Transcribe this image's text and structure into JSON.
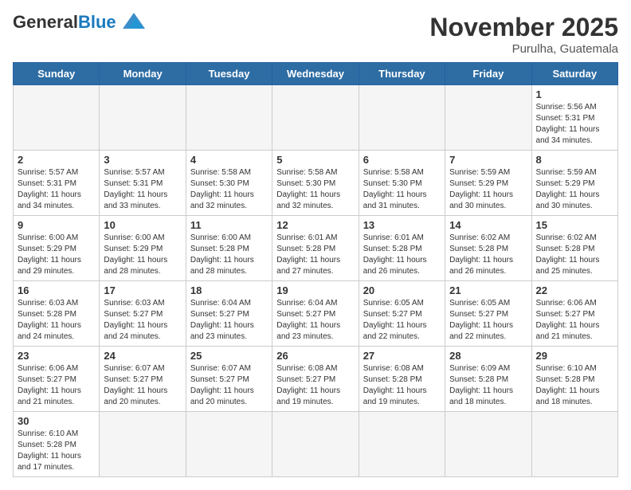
{
  "header": {
    "logo_general": "General",
    "logo_blue": "Blue",
    "month_title": "November 2025",
    "location": "Purulha, Guatemala"
  },
  "weekdays": [
    "Sunday",
    "Monday",
    "Tuesday",
    "Wednesday",
    "Thursday",
    "Friday",
    "Saturday"
  ],
  "weeks": [
    [
      {
        "day": "",
        "empty": true,
        "text": ""
      },
      {
        "day": "",
        "empty": true,
        "text": ""
      },
      {
        "day": "",
        "empty": true,
        "text": ""
      },
      {
        "day": "",
        "empty": true,
        "text": ""
      },
      {
        "day": "",
        "empty": true,
        "text": ""
      },
      {
        "day": "",
        "empty": true,
        "text": ""
      },
      {
        "day": "1",
        "empty": false,
        "text": "Sunrise: 5:56 AM\nSunset: 5:31 PM\nDaylight: 11 hours\nand 34 minutes."
      }
    ],
    [
      {
        "day": "2",
        "empty": false,
        "text": "Sunrise: 5:57 AM\nSunset: 5:31 PM\nDaylight: 11 hours\nand 34 minutes."
      },
      {
        "day": "3",
        "empty": false,
        "text": "Sunrise: 5:57 AM\nSunset: 5:31 PM\nDaylight: 11 hours\nand 33 minutes."
      },
      {
        "day": "4",
        "empty": false,
        "text": "Sunrise: 5:58 AM\nSunset: 5:30 PM\nDaylight: 11 hours\nand 32 minutes."
      },
      {
        "day": "5",
        "empty": false,
        "text": "Sunrise: 5:58 AM\nSunset: 5:30 PM\nDaylight: 11 hours\nand 32 minutes."
      },
      {
        "day": "6",
        "empty": false,
        "text": "Sunrise: 5:58 AM\nSunset: 5:30 PM\nDaylight: 11 hours\nand 31 minutes."
      },
      {
        "day": "7",
        "empty": false,
        "text": "Sunrise: 5:59 AM\nSunset: 5:29 PM\nDaylight: 11 hours\nand 30 minutes."
      },
      {
        "day": "8",
        "empty": false,
        "text": "Sunrise: 5:59 AM\nSunset: 5:29 PM\nDaylight: 11 hours\nand 30 minutes."
      }
    ],
    [
      {
        "day": "9",
        "empty": false,
        "text": "Sunrise: 6:00 AM\nSunset: 5:29 PM\nDaylight: 11 hours\nand 29 minutes."
      },
      {
        "day": "10",
        "empty": false,
        "text": "Sunrise: 6:00 AM\nSunset: 5:29 PM\nDaylight: 11 hours\nand 28 minutes."
      },
      {
        "day": "11",
        "empty": false,
        "text": "Sunrise: 6:00 AM\nSunset: 5:28 PM\nDaylight: 11 hours\nand 28 minutes."
      },
      {
        "day": "12",
        "empty": false,
        "text": "Sunrise: 6:01 AM\nSunset: 5:28 PM\nDaylight: 11 hours\nand 27 minutes."
      },
      {
        "day": "13",
        "empty": false,
        "text": "Sunrise: 6:01 AM\nSunset: 5:28 PM\nDaylight: 11 hours\nand 26 minutes."
      },
      {
        "day": "14",
        "empty": false,
        "text": "Sunrise: 6:02 AM\nSunset: 5:28 PM\nDaylight: 11 hours\nand 26 minutes."
      },
      {
        "day": "15",
        "empty": false,
        "text": "Sunrise: 6:02 AM\nSunset: 5:28 PM\nDaylight: 11 hours\nand 25 minutes."
      }
    ],
    [
      {
        "day": "16",
        "empty": false,
        "text": "Sunrise: 6:03 AM\nSunset: 5:28 PM\nDaylight: 11 hours\nand 24 minutes."
      },
      {
        "day": "17",
        "empty": false,
        "text": "Sunrise: 6:03 AM\nSunset: 5:27 PM\nDaylight: 11 hours\nand 24 minutes."
      },
      {
        "day": "18",
        "empty": false,
        "text": "Sunrise: 6:04 AM\nSunset: 5:27 PM\nDaylight: 11 hours\nand 23 minutes."
      },
      {
        "day": "19",
        "empty": false,
        "text": "Sunrise: 6:04 AM\nSunset: 5:27 PM\nDaylight: 11 hours\nand 23 minutes."
      },
      {
        "day": "20",
        "empty": false,
        "text": "Sunrise: 6:05 AM\nSunset: 5:27 PM\nDaylight: 11 hours\nand 22 minutes."
      },
      {
        "day": "21",
        "empty": false,
        "text": "Sunrise: 6:05 AM\nSunset: 5:27 PM\nDaylight: 11 hours\nand 22 minutes."
      },
      {
        "day": "22",
        "empty": false,
        "text": "Sunrise: 6:06 AM\nSunset: 5:27 PM\nDaylight: 11 hours\nand 21 minutes."
      }
    ],
    [
      {
        "day": "23",
        "empty": false,
        "text": "Sunrise: 6:06 AM\nSunset: 5:27 PM\nDaylight: 11 hours\nand 21 minutes."
      },
      {
        "day": "24",
        "empty": false,
        "text": "Sunrise: 6:07 AM\nSunset: 5:27 PM\nDaylight: 11 hours\nand 20 minutes."
      },
      {
        "day": "25",
        "empty": false,
        "text": "Sunrise: 6:07 AM\nSunset: 5:27 PM\nDaylight: 11 hours\nand 20 minutes."
      },
      {
        "day": "26",
        "empty": false,
        "text": "Sunrise: 6:08 AM\nSunset: 5:27 PM\nDaylight: 11 hours\nand 19 minutes."
      },
      {
        "day": "27",
        "empty": false,
        "text": "Sunrise: 6:08 AM\nSunset: 5:28 PM\nDaylight: 11 hours\nand 19 minutes."
      },
      {
        "day": "28",
        "empty": false,
        "text": "Sunrise: 6:09 AM\nSunset: 5:28 PM\nDaylight: 11 hours\nand 18 minutes."
      },
      {
        "day": "29",
        "empty": false,
        "text": "Sunrise: 6:10 AM\nSunset: 5:28 PM\nDaylight: 11 hours\nand 18 minutes."
      }
    ],
    [
      {
        "day": "30",
        "empty": false,
        "text": "Sunrise: 6:10 AM\nSunset: 5:28 PM\nDaylight: 11 hours\nand 17 minutes."
      },
      {
        "day": "",
        "empty": true,
        "text": ""
      },
      {
        "day": "",
        "empty": true,
        "text": ""
      },
      {
        "day": "",
        "empty": true,
        "text": ""
      },
      {
        "day": "",
        "empty": true,
        "text": ""
      },
      {
        "day": "",
        "empty": true,
        "text": ""
      },
      {
        "day": "",
        "empty": true,
        "text": ""
      }
    ]
  ]
}
